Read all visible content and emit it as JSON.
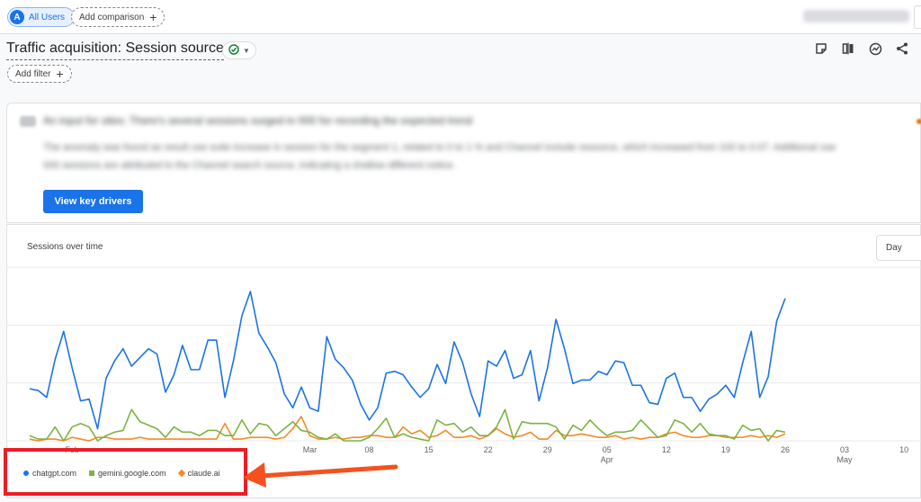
{
  "top_bar": {
    "segment_avatar_letter": "A",
    "segment_label": "All Users",
    "compare_label": "Add comparison"
  },
  "header": {
    "title": "Traffic acquisition: Session source",
    "filter_label": "Add filter",
    "toolbar_icons": [
      "customize-report-icon",
      "compare-icon",
      "insights-icon",
      "share-icon"
    ]
  },
  "insight": {
    "headline": "An input for sites: There's several sessions surged in 000 for recording the expected trend",
    "line1": "The anomaly was found as result use suite increase in session for the segment 1, related to 0 to 1 % and Channel include resource, which increased from 100 to 0.07. Additional use",
    "line2": "000 sessions are attributed to the Channel search source, indicating a shallow different notice.",
    "button_label": "View key drivers"
  },
  "chart": {
    "title": "Sessions over time",
    "period": "Day"
  },
  "chart_data": {
    "type": "line",
    "title": "Sessions over time",
    "x_ticks": [
      {
        "day": 15,
        "day_label": "Feb",
        "month_label": ""
      },
      {
        "day": 43,
        "day_label": "Mar",
        "month_label": ""
      },
      {
        "day": 50,
        "day_label": "08",
        "month_label": ""
      },
      {
        "day": 57,
        "day_label": "15",
        "month_label": ""
      },
      {
        "day": 64,
        "day_label": "22",
        "month_label": ""
      },
      {
        "day": 71,
        "day_label": "29",
        "month_label": ""
      },
      {
        "day": 78,
        "day_label": "05",
        "month_label": "Apr"
      },
      {
        "day": 85,
        "day_label": "12",
        "month_label": ""
      },
      {
        "day": 92,
        "day_label": "19",
        "month_label": ""
      },
      {
        "day": 99,
        "day_label": "26",
        "month_label": ""
      },
      {
        "day": 106,
        "day_label": "03",
        "month_label": "May"
      },
      {
        "day": 113,
        "day_label": "10",
        "month_label": ""
      }
    ],
    "x_range": [
      10,
      115
    ],
    "ylim": [
      0,
      100
    ],
    "grid": true,
    "legend": "bottom-left",
    "series": [
      {
        "name": "chatgpt.com",
        "color": "#1a73e8",
        "values": [
          30,
          29,
          25,
          47,
          63,
          42,
          23,
          24,
          7,
          36,
          46,
          53,
          43,
          48,
          53,
          50,
          28,
          38,
          55,
          41,
          41,
          58,
          58,
          25,
          46,
          72,
          86,
          62,
          54,
          45,
          27,
          19,
          31,
          19,
          17,
          60,
          47,
          42,
          35,
          21,
          12,
          19,
          39,
          40,
          38,
          31,
          25,
          30,
          44,
          33,
          57,
          45,
          27,
          14,
          46,
          43,
          52,
          36,
          38,
          52,
          23,
          42,
          70,
          53,
          33,
          35,
          35,
          40,
          38,
          46,
          45,
          32,
          32,
          22,
          21,
          36,
          39,
          25,
          25,
          17,
          24,
          27,
          32,
          25,
          45,
          63,
          25,
          37,
          69,
          82
        ]
      },
      {
        "name": "gemini.google.com",
        "color": "#7cb342",
        "values": [
          3,
          1,
          1,
          8,
          0,
          8,
          10,
          8,
          0,
          3,
          5,
          6,
          18,
          11,
          9,
          7,
          2,
          8,
          5,
          5,
          3,
          6,
          6,
          3,
          3,
          12,
          4,
          10,
          9,
          3,
          7,
          11,
          6,
          5,
          2,
          1,
          4,
          0,
          0,
          0,
          2,
          7,
          13,
          2,
          4,
          2,
          1,
          0,
          12,
          9,
          10,
          5,
          8,
          3,
          3,
          8,
          18,
          1,
          11,
          10,
          10,
          10,
          8,
          1,
          9,
          6,
          12,
          7,
          3,
          5,
          5,
          6,
          12,
          7,
          2,
          3,
          12,
          10,
          5,
          10,
          4,
          3,
          3,
          1,
          9,
          6,
          7,
          0,
          6,
          5
        ]
      },
      {
        "name": "claude.ai",
        "color": "#f28c28",
        "values": [
          1,
          0,
          1,
          1,
          0,
          2,
          1,
          0,
          2,
          2,
          1,
          1,
          1,
          2,
          1,
          1,
          1,
          1,
          1,
          1,
          1,
          1,
          1,
          10,
          1,
          1,
          2,
          2,
          2,
          1,
          2,
          7,
          14,
          3,
          1,
          1,
          2,
          1,
          2,
          2,
          3,
          3,
          2,
          2,
          8,
          4,
          6,
          2,
          3,
          6,
          2,
          2,
          3,
          1,
          3,
          7,
          4,
          2,
          3,
          5,
          1,
          1,
          6,
          3,
          3,
          4,
          3,
          2,
          2,
          3,
          1,
          2,
          1,
          2,
          2,
          4,
          5,
          3,
          2,
          2,
          3,
          3,
          2,
          2,
          2,
          3,
          2,
          3,
          2,
          4
        ]
      }
    ]
  },
  "annotation": {
    "box_color": "#ee1d23",
    "arrow_color": "#f4511e"
  }
}
